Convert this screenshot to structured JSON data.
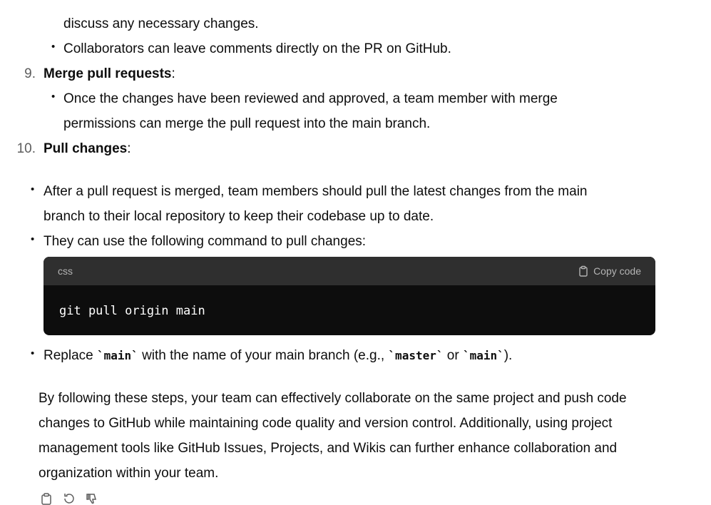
{
  "list": {
    "item8_cont": "discuss any necessary changes.",
    "item8_bullet2": "Collaborators can leave comments directly on the PR on GitHub.",
    "item9": {
      "num": "9.",
      "title": "Merge pull requests",
      "colon": ":"
    },
    "item9_bullet1_line1": "Once the changes have been reviewed and approved, a team member with merge",
    "item9_bullet1_line2": "permissions can merge the pull request into the main branch.",
    "item10": {
      "num": "10.",
      "title": "Pull changes",
      "colon": ":"
    }
  },
  "subbullets": {
    "b1_line1": "After a pull request is merged, team members should pull the latest changes from the main",
    "b1_line2": "branch to their local repository to keep their codebase up to date.",
    "b2": "They can use the following command to pull changes:",
    "b3_pre": "Replace ",
    "b3_code1": "`main`",
    "b3_mid": " with the name of your main branch (e.g., ",
    "b3_code2": "`master`",
    "b3_or": " or ",
    "b3_code3": "`main`",
    "b3_end": ")."
  },
  "code_block": {
    "language": "css",
    "copy_label": "Copy code",
    "code": "git pull origin main"
  },
  "summary": {
    "line1": "By following these steps, your team can effectively collaborate on the same project and push code",
    "line2": "changes to GitHub while maintaining code quality and version control. Additionally, using project",
    "line3": "management tools like GitHub Issues, Projects, and Wikis can further enhance collaboration and",
    "line4": "organization within your team."
  },
  "icons": [
    "copy-icon",
    "regenerate-icon",
    "thumbs-down-icon"
  ]
}
